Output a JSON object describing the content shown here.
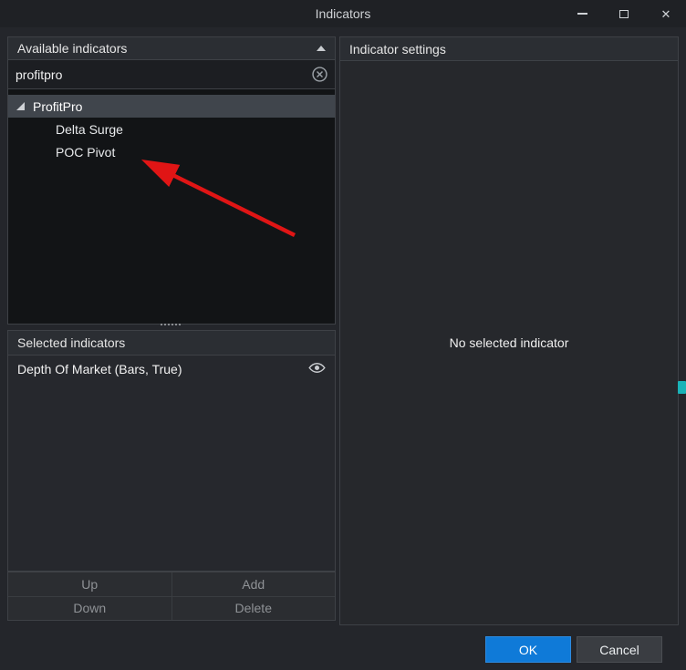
{
  "window": {
    "title": "Indicators"
  },
  "left_panel": {
    "available_header": "Available indicators",
    "search_value": "profitpro",
    "tree": {
      "group_label": "ProfitPro",
      "children": [
        "Delta Surge",
        "POC Pivot"
      ]
    },
    "selected_header": "Selected indicators",
    "selected_items": [
      {
        "label": "Depth Of Market (Bars, True)"
      }
    ],
    "buttons": {
      "up": "Up",
      "add": "Add",
      "down": "Down",
      "delete": "Delete"
    }
  },
  "right_panel": {
    "header": "Indicator settings",
    "empty_message": "No selected indicator"
  },
  "footer": {
    "ok_label": "OK",
    "cancel_label": "Cancel"
  },
  "colors": {
    "accent_blue": "#0f7ad8",
    "arrow_red": "#e01515",
    "edge_marker_teal": "#19b3b8"
  }
}
